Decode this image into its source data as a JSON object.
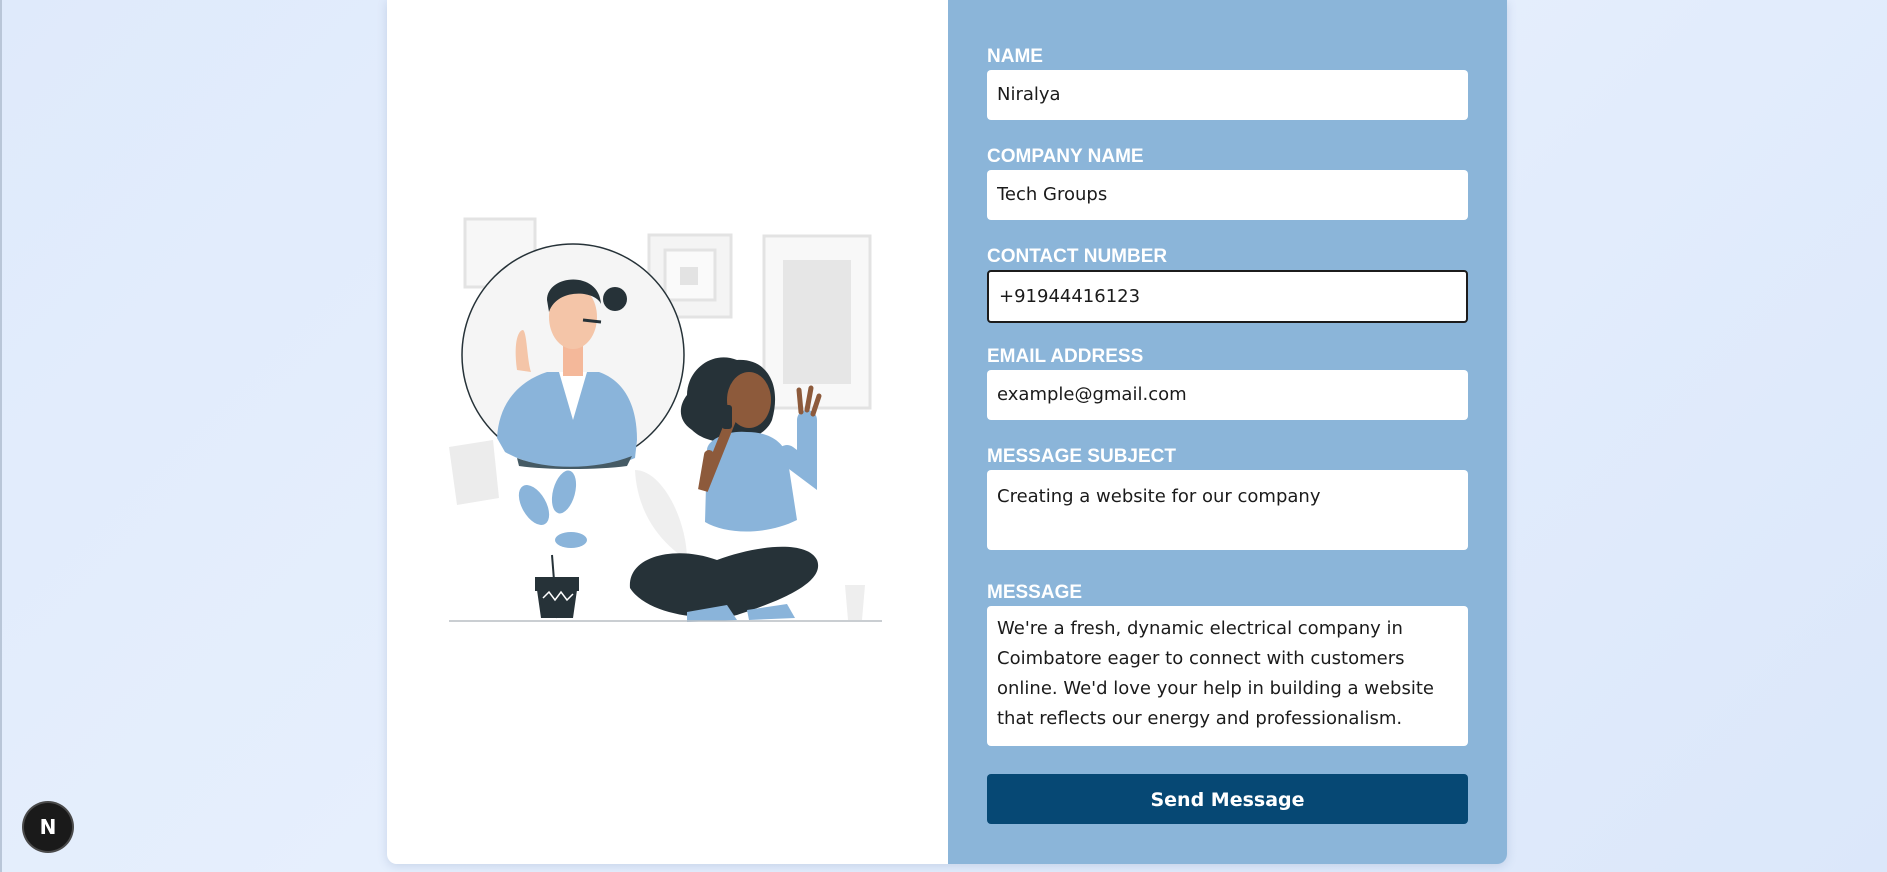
{
  "form": {
    "name": {
      "label": "NAME",
      "value": "Niralya"
    },
    "company": {
      "label": "COMPANY NAME",
      "value": "Tech Groups"
    },
    "contact": {
      "label": "CONTACT NUMBER",
      "value": "+91944416123"
    },
    "email": {
      "label": "EMAIL ADDRESS",
      "value": "example@gmail.com"
    },
    "subject": {
      "label": "MESSAGE SUBJECT",
      "value": "Creating a website for our company"
    },
    "message": {
      "label": "MESSAGE",
      "value": "We're a fresh, dynamic electrical company in Coimbatore eager to connect with customers online. We'd love your help in building a website that reflects our energy and professionalism."
    },
    "submit_label": "Send Message"
  },
  "badge": {
    "letter": "N"
  },
  "colors": {
    "panel": "#8bb5d9",
    "button": "#064874",
    "accent_blue": "#8ab4da",
    "dark": "#263238"
  }
}
